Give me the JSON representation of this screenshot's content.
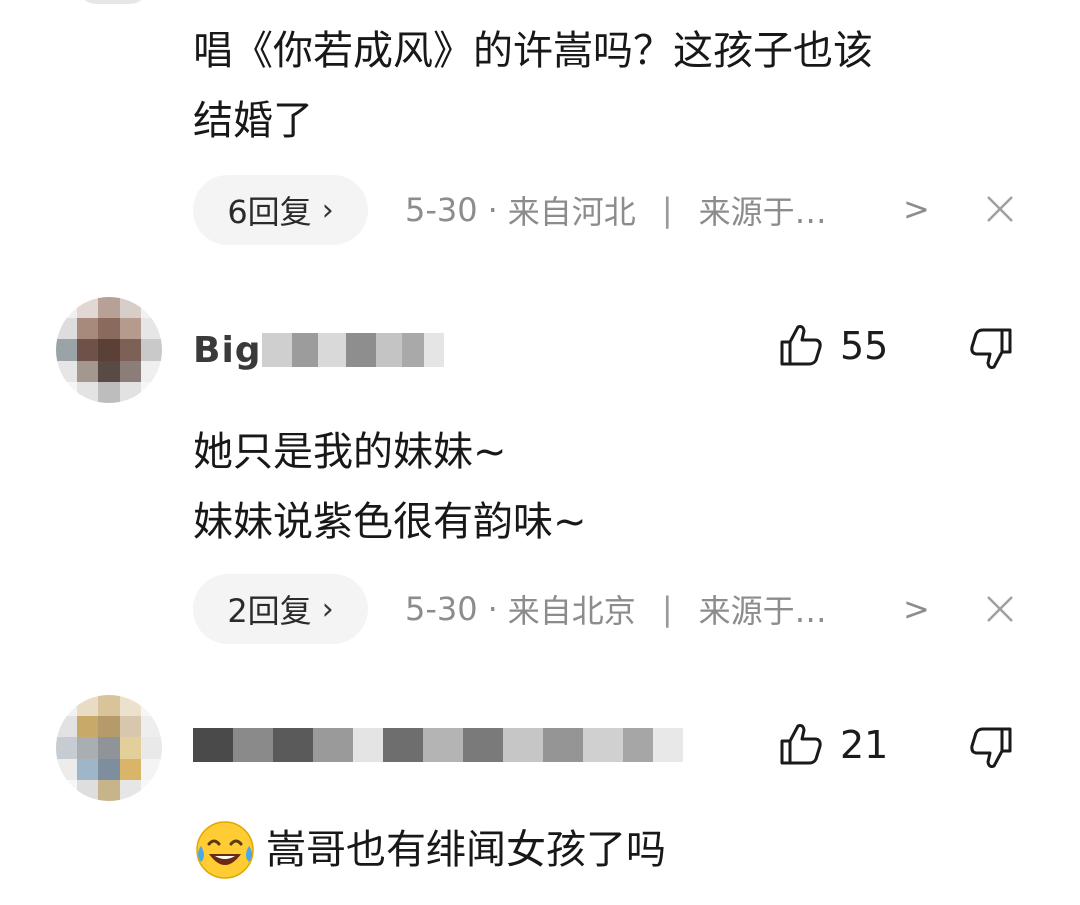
{
  "comments": [
    {
      "text_lines": [
        "唱《你若成风》的许嵩吗？这孩子也该",
        "结婚了"
      ],
      "reply_label": "6回复",
      "date": "5-30",
      "location": "来自河北",
      "source": "来源于…"
    },
    {
      "username": "Big",
      "likes": "55",
      "text_lines": [
        "她只是我的妹妹~",
        "妹妹说紫色很有韵味~"
      ],
      "reply_label": "2回复",
      "date": "5-30",
      "location": "来自北京",
      "source": "来源于…"
    },
    {
      "likes": "21",
      "emoji": "😂",
      "text": "嵩哥也有绯闻女孩了吗"
    }
  ],
  "glyphs": {
    "chevron": "›",
    "separator_dot": "·",
    "separator_bar": "|",
    "more_arrow": ">",
    "close": "✕"
  },
  "icons": [
    "thumbs-up-icon",
    "thumbs-down-icon",
    "chevron-right-icon",
    "close-icon",
    "crying-laughing-emoji"
  ]
}
